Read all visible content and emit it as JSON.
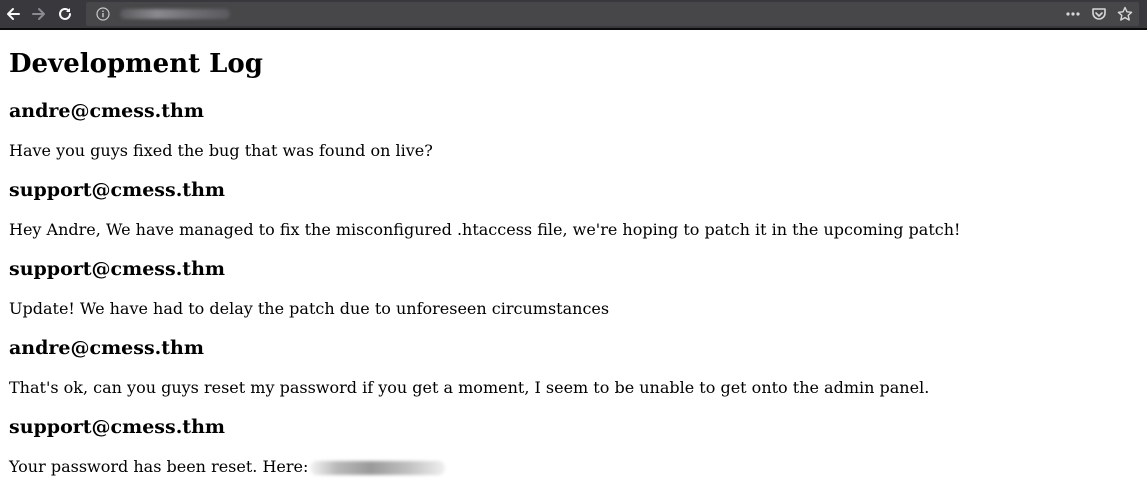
{
  "browser": {
    "icons": {
      "back": "arrow-left-icon",
      "forward": "arrow-right-icon",
      "reload": "reload-icon",
      "info": "info-icon",
      "more": "more-horizontal-icon",
      "pocket": "pocket-icon",
      "bookmark": "star-icon"
    }
  },
  "page": {
    "title": "Development Log",
    "entries": [
      {
        "author": "andre@cmess.thm",
        "message": "Have you guys fixed the bug that was found on live?"
      },
      {
        "author": "support@cmess.thm",
        "message": "Hey Andre, We have managed to fix the misconfigured .htaccess file, we're hoping to patch it in the upcoming patch!"
      },
      {
        "author": "support@cmess.thm",
        "message": "Update! We have had to delay the patch due to unforeseen circumstances"
      },
      {
        "author": "andre@cmess.thm",
        "message": "That's ok, can you guys reset my password if you get a moment, I seem to be unable to get onto the admin panel."
      },
      {
        "author": "support@cmess.thm",
        "message": "Your password has been reset. Here:"
      }
    ]
  }
}
